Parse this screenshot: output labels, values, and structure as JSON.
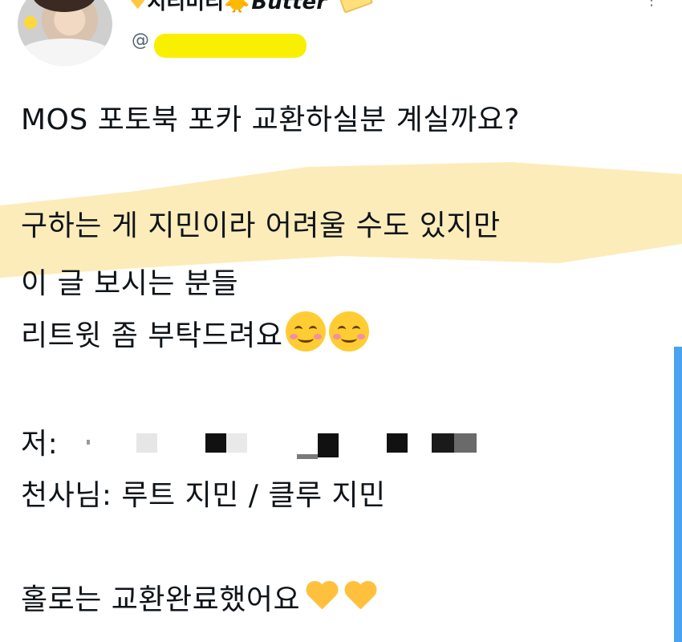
{
  "author": {
    "display_name_text": "지리미리",
    "display_name_suffix": "Butter",
    "handle_prefix": "@"
  },
  "tweet": {
    "lines": [
      "MOS 포토북 포카 교환하실분 계실까요?",
      "구하는 게 지민이라 어려울 수도 있지만",
      "이 글 보시는 분들",
      "리트윗 좀 부탁드려요",
      "저:",
      "천사님: 루트 지민 / 클루 지민",
      "홀로는 교환완료했어요"
    ]
  },
  "icons": {
    "name_heart": "yellow-heart-icon",
    "name_chick": "baby-chick-icon",
    "name_butter": "butter-icon",
    "menu": "more-options-icon",
    "smile": "smiling-face-with-smiling-eyes-icon",
    "heart": "yellow-heart-icon"
  },
  "colors": {
    "highlight": "#fcebb6",
    "handle_redaction": "#f8f000",
    "accent_blue": "#4aa3f0"
  }
}
